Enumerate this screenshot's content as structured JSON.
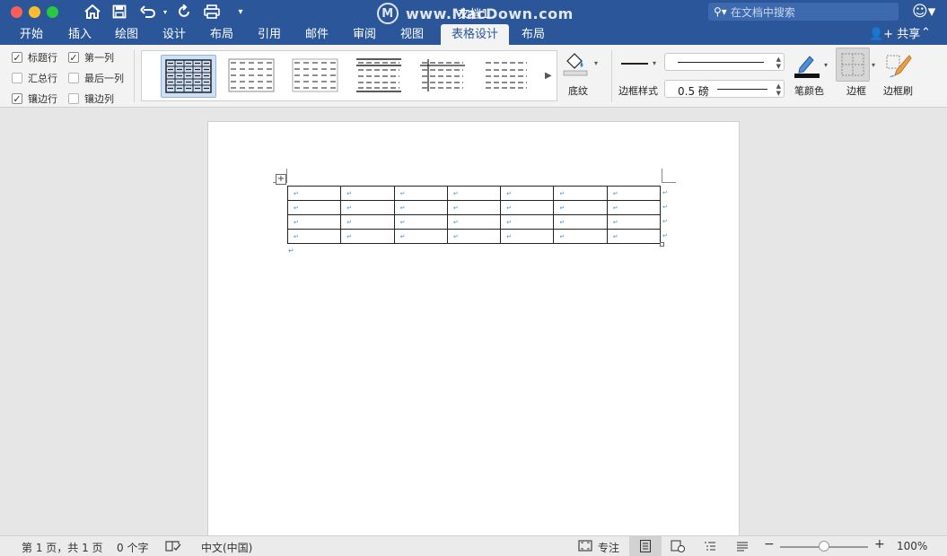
{
  "window": {
    "title": "文档1",
    "watermark": "www.MacDown.com",
    "watermark_logo": "M",
    "search_placeholder": "在文档中搜索"
  },
  "quick_access": [
    "home-icon",
    "save-icon",
    "undo-icon",
    "redo-icon",
    "print-icon",
    "customize-icon"
  ],
  "tabs": [
    {
      "label": "开始"
    },
    {
      "label": "插入"
    },
    {
      "label": "绘图"
    },
    {
      "label": "设计"
    },
    {
      "label": "布局"
    },
    {
      "label": "引用"
    },
    {
      "label": "邮件"
    },
    {
      "label": "审阅"
    },
    {
      "label": "视图"
    },
    {
      "label": "表格设计",
      "active": true
    },
    {
      "label": "布局"
    }
  ],
  "share_label": "共享",
  "options": {
    "header_row": {
      "label": "标题行",
      "checked": true
    },
    "total_row": {
      "label": "汇总行",
      "checked": false
    },
    "banded_rows": {
      "label": "镶边行",
      "checked": true
    },
    "first_column": {
      "label": "第一列",
      "checked": true
    },
    "last_column": {
      "label": "最后一列",
      "checked": false
    },
    "banded_columns": {
      "label": "镶边列",
      "checked": false
    }
  },
  "ribbon": {
    "shading_label": "底纹",
    "border_styles_label": "边框样式",
    "pen_weight": "0.5 磅",
    "pen_color_label": "笔颜色",
    "borders_label": "边框",
    "border_painter_label": "边框刷"
  },
  "document": {
    "table": {
      "rows": 4,
      "columns": 7,
      "cell_mark": "↵"
    }
  },
  "status": {
    "page": "第 1 页，共 1 页",
    "words": "0 个字",
    "language": "中文(中国)",
    "focus": "专注",
    "zoom": "100%",
    "zoom_fraction": 0.5
  },
  "colors": {
    "accent": "#2b579a",
    "ribbon_bg": "#f3f3f3",
    "paragraph_mark": "#4a90d9"
  }
}
